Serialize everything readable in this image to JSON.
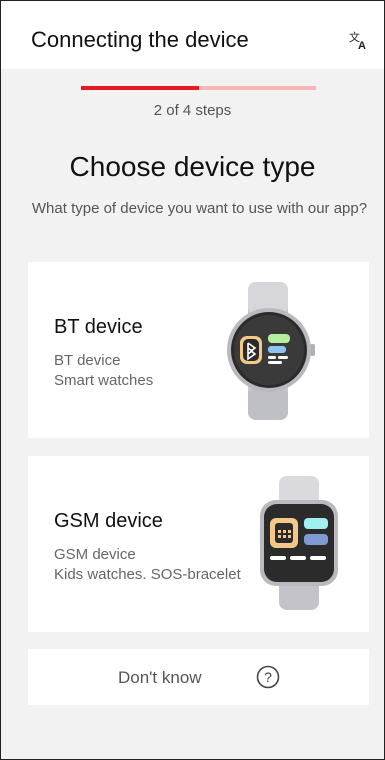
{
  "header": {
    "title": "Connecting the device",
    "translate_icon": "translate-icon"
  },
  "progress": {
    "current_step": 2,
    "total_steps": 4,
    "label": "2  of 4 steps",
    "fraction": 0.5,
    "colors": {
      "fill": "#e31d1d",
      "track": "#f6b7b7"
    }
  },
  "main": {
    "title": "Choose device type",
    "subtitle": "What type of device you want to use with our app?"
  },
  "options": [
    {
      "title": "BT device",
      "line1": "BT device",
      "line2": "Smart watches",
      "icon": "bluetooth-smartwatch-icon"
    },
    {
      "title": "GSM device",
      "line1": "GSM device",
      "line2": "Kids watches. SOS-bracelet",
      "icon": "gsm-kids-watch-icon"
    }
  ],
  "dont_know": {
    "label": "Don't know",
    "icon": "question-circle-icon"
  }
}
